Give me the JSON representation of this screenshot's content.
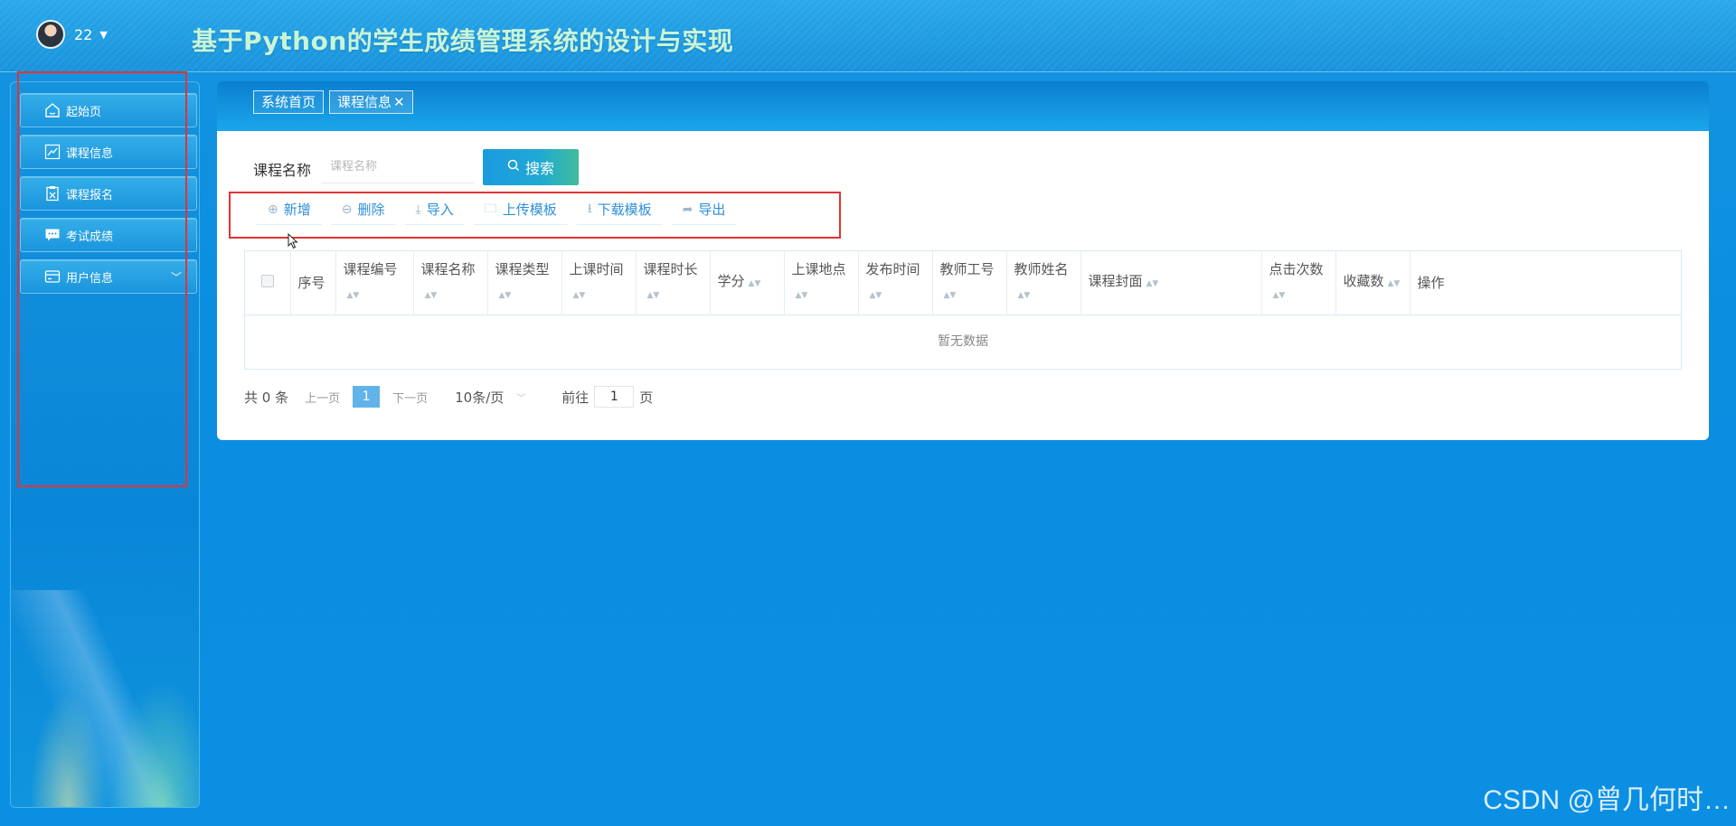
{
  "header": {
    "user_name": "22",
    "system_title": "基于Python的学生成绩管理系统的设计与实现"
  },
  "sidebar": {
    "items": [
      {
        "label": "起始页",
        "icon": "home-icon"
      },
      {
        "label": "课程信息",
        "icon": "chart-icon"
      },
      {
        "label": "课程报名",
        "icon": "clipboard-icon"
      },
      {
        "label": "考试成绩",
        "icon": "chat-icon"
      },
      {
        "label": "用户信息",
        "icon": "card-icon"
      }
    ]
  },
  "tabs": [
    {
      "label": "系统首页"
    },
    {
      "label": "课程信息"
    }
  ],
  "search": {
    "label": "课程名称",
    "placeholder": "课程名称",
    "button_label": "搜索"
  },
  "toolbar": {
    "add": "新增",
    "delete": "删除",
    "import": "导入",
    "upload_template": "上传模板",
    "download_template": "下载模板",
    "export": "导出"
  },
  "table": {
    "columns": [
      "序号",
      "课程编号",
      "课程名称",
      "课程类型",
      "上课时间",
      "课程时长",
      "学分",
      "上课地点",
      "发布时间",
      "教师工号",
      "教师姓名",
      "课程封面",
      "点击次数",
      "收藏数",
      "操作"
    ],
    "empty_text": "暂无数据"
  },
  "pagination": {
    "total_text": "共 0 条",
    "prev": "上一页",
    "current_page": "1",
    "next": "下一页",
    "page_size": "10条/页",
    "goto_label": "前往",
    "goto_value": "1",
    "goto_suffix": "页"
  },
  "watermark": "CSDN @曾几何时…"
}
